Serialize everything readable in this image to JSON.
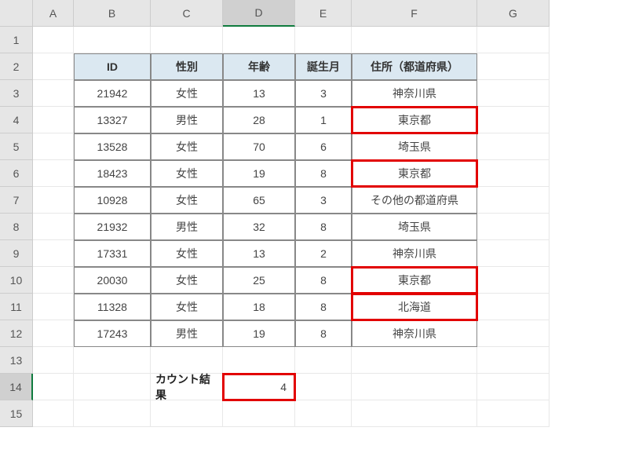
{
  "columns": [
    "A",
    "B",
    "C",
    "D",
    "E",
    "F",
    "G"
  ],
  "selected_col": "D",
  "selected_row": 14,
  "headers": {
    "id": "ID",
    "gender": "性別",
    "age": "年齢",
    "birth_month": "誕生月",
    "address": "住所（都道府県）"
  },
  "rows": [
    {
      "id": "21942",
      "gender": "女性",
      "age": "13",
      "month": "3",
      "addr": "神奈川県",
      "hl": false
    },
    {
      "id": "13327",
      "gender": "男性",
      "age": "28",
      "month": "1",
      "addr": "東京都",
      "hl": true
    },
    {
      "id": "13528",
      "gender": "女性",
      "age": "70",
      "month": "6",
      "addr": "埼玉県",
      "hl": false
    },
    {
      "id": "18423",
      "gender": "女性",
      "age": "19",
      "month": "8",
      "addr": "東京都",
      "hl": true
    },
    {
      "id": "10928",
      "gender": "女性",
      "age": "65",
      "month": "3",
      "addr": "その他の都道府県",
      "hl": false
    },
    {
      "id": "21932",
      "gender": "男性",
      "age": "32",
      "month": "8",
      "addr": "埼玉県",
      "hl": false
    },
    {
      "id": "17331",
      "gender": "女性",
      "age": "13",
      "month": "2",
      "addr": "神奈川県",
      "hl": false
    },
    {
      "id": "20030",
      "gender": "女性",
      "age": "25",
      "month": "8",
      "addr": "東京都",
      "hl": true
    },
    {
      "id": "11328",
      "gender": "女性",
      "age": "18",
      "month": "8",
      "addr": "北海道",
      "hl": true
    },
    {
      "id": "17243",
      "gender": "男性",
      "age": "19",
      "month": "8",
      "addr": "神奈川県",
      "hl": false
    }
  ],
  "result_label": "カウント結果",
  "result_value": "4",
  "chart_data": {
    "type": "table",
    "title": "",
    "columns": [
      "ID",
      "性別",
      "年齢",
      "誕生月",
      "住所（都道府県）"
    ],
    "data": [
      [
        21942,
        "女性",
        13,
        3,
        "神奈川県"
      ],
      [
        13327,
        "男性",
        28,
        1,
        "東京都"
      ],
      [
        13528,
        "女性",
        70,
        6,
        "埼玉県"
      ],
      [
        18423,
        "女性",
        19,
        8,
        "東京都"
      ],
      [
        10928,
        "女性",
        65,
        3,
        "その他の都道府県"
      ],
      [
        21932,
        "男性",
        32,
        8,
        "埼玉県"
      ],
      [
        17331,
        "女性",
        13,
        2,
        "神奈川県"
      ],
      [
        20030,
        "女性",
        25,
        8,
        "東京都"
      ],
      [
        11328,
        "女性",
        18,
        8,
        "北海道"
      ],
      [
        17243,
        "男性",
        19,
        8,
        "神奈川県"
      ]
    ],
    "summary": {
      "label": "カウント結果",
      "value": 4
    }
  }
}
